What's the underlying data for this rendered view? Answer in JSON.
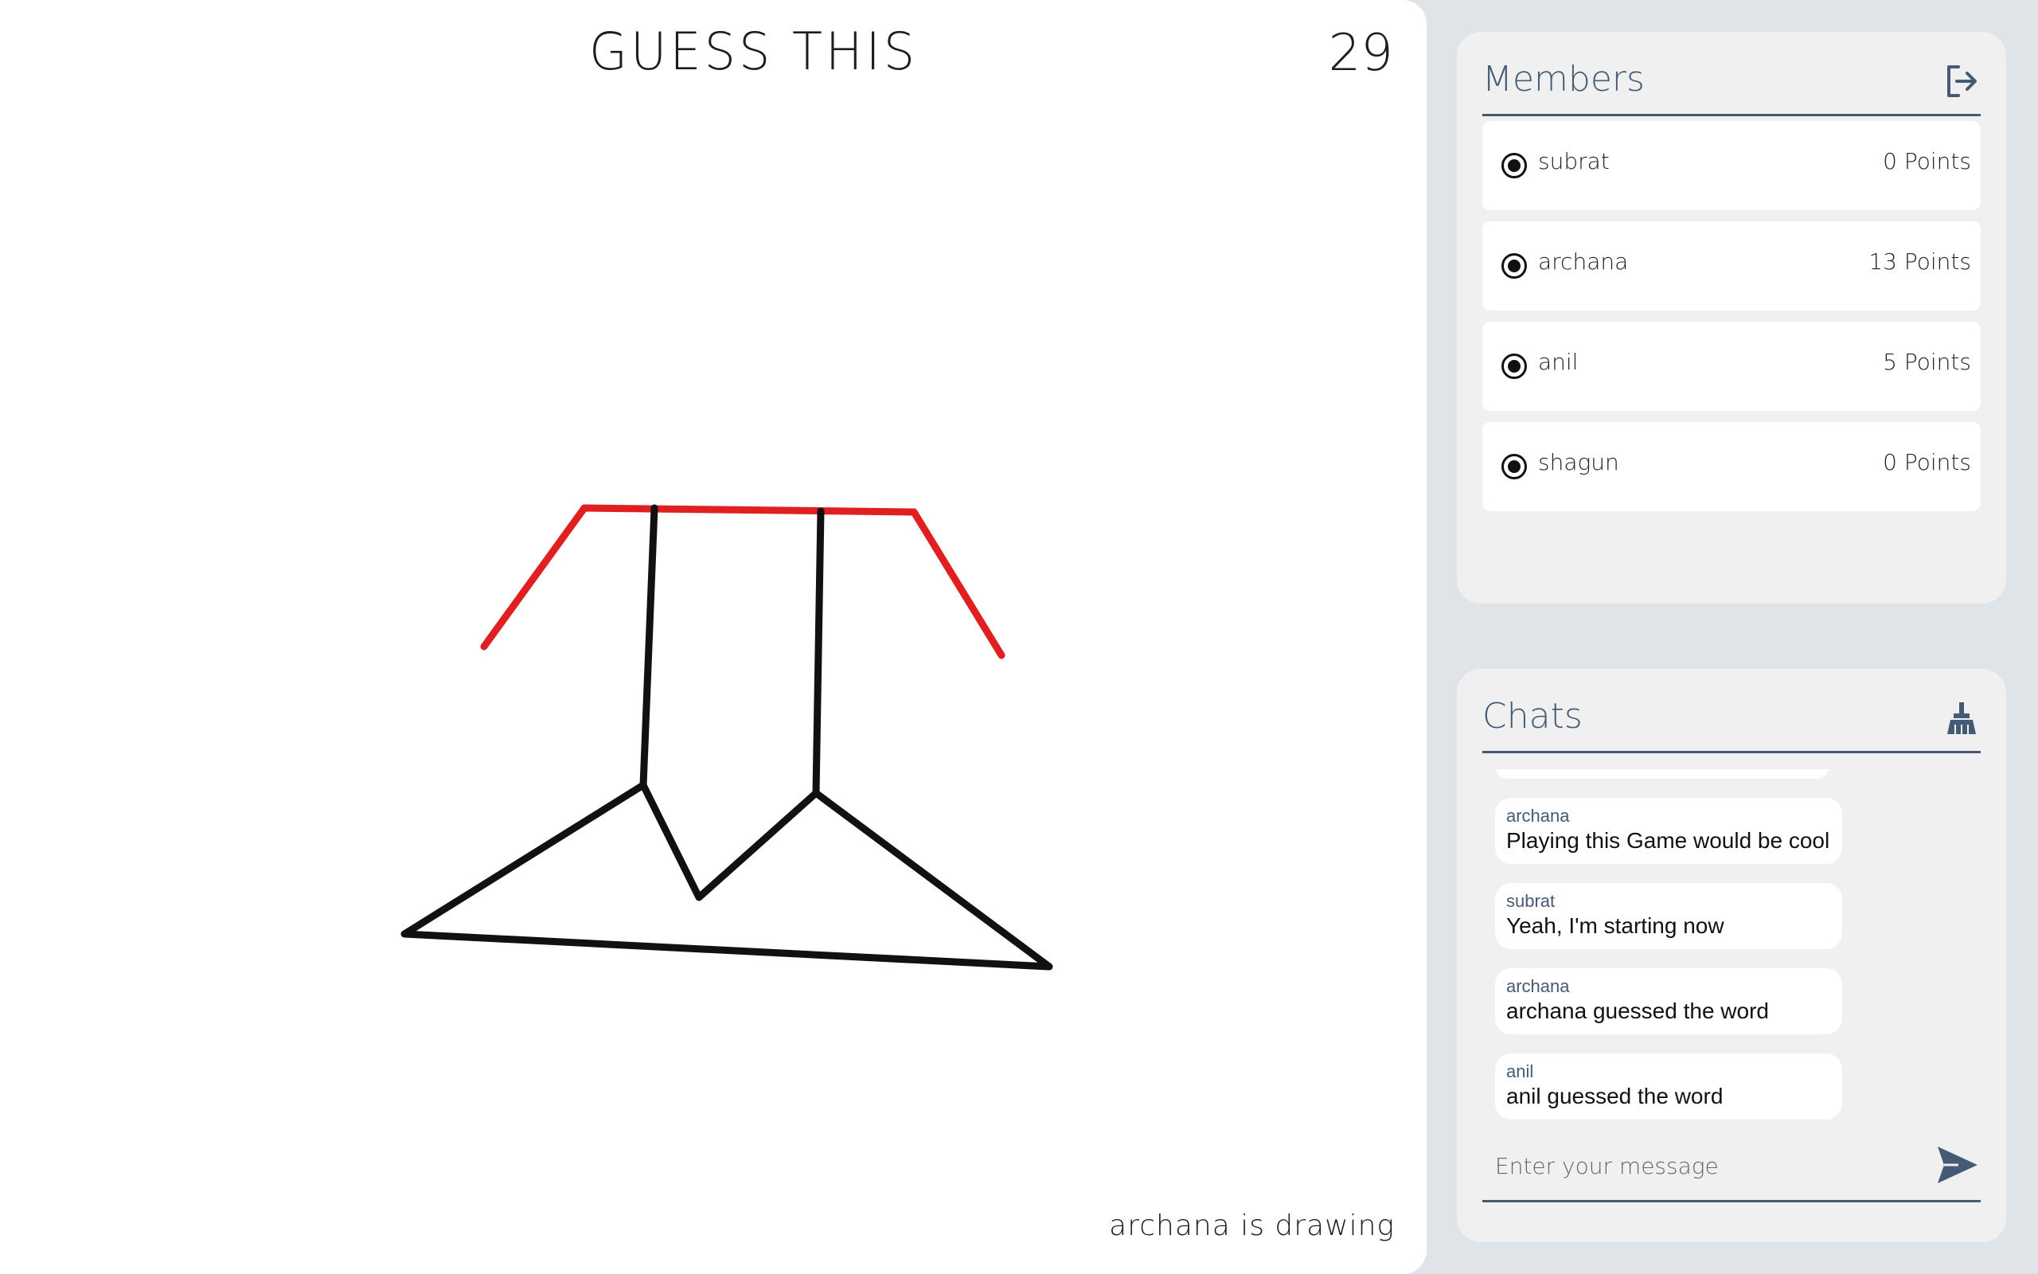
{
  "game": {
    "word_hint": "GUESS THIS",
    "timer": "29",
    "drawer_status": "archana is drawing"
  },
  "canvas": {
    "stroke_colors": {
      "red": "#e02020",
      "black": "#111111"
    }
  },
  "members": {
    "title": "Members",
    "leave_icon": "sign-out-icon",
    "list": [
      {
        "name": "subrat",
        "points": "0 Points"
      },
      {
        "name": "archana",
        "points": "13 Points"
      },
      {
        "name": "anil",
        "points": "5 Points"
      },
      {
        "name": "shagun",
        "points": "0 Points"
      }
    ]
  },
  "chats": {
    "title": "Chats",
    "clear_icon": "broom-icon",
    "messages": [
      {
        "sender": "archana",
        "text": "Playing this Game would be cool"
      },
      {
        "sender": "subrat",
        "text": "Yeah, I'm starting now"
      },
      {
        "sender": "archana",
        "text": "archana guessed the word"
      },
      {
        "sender": "anil",
        "text": "anil guessed the word"
      }
    ],
    "input_placeholder": "Enter your message",
    "send_icon": "paper-plane-icon"
  },
  "colors": {
    "accent": "#455a75",
    "panel_bg": "#f0f0f0",
    "page_bg": "#dfe4e8"
  }
}
